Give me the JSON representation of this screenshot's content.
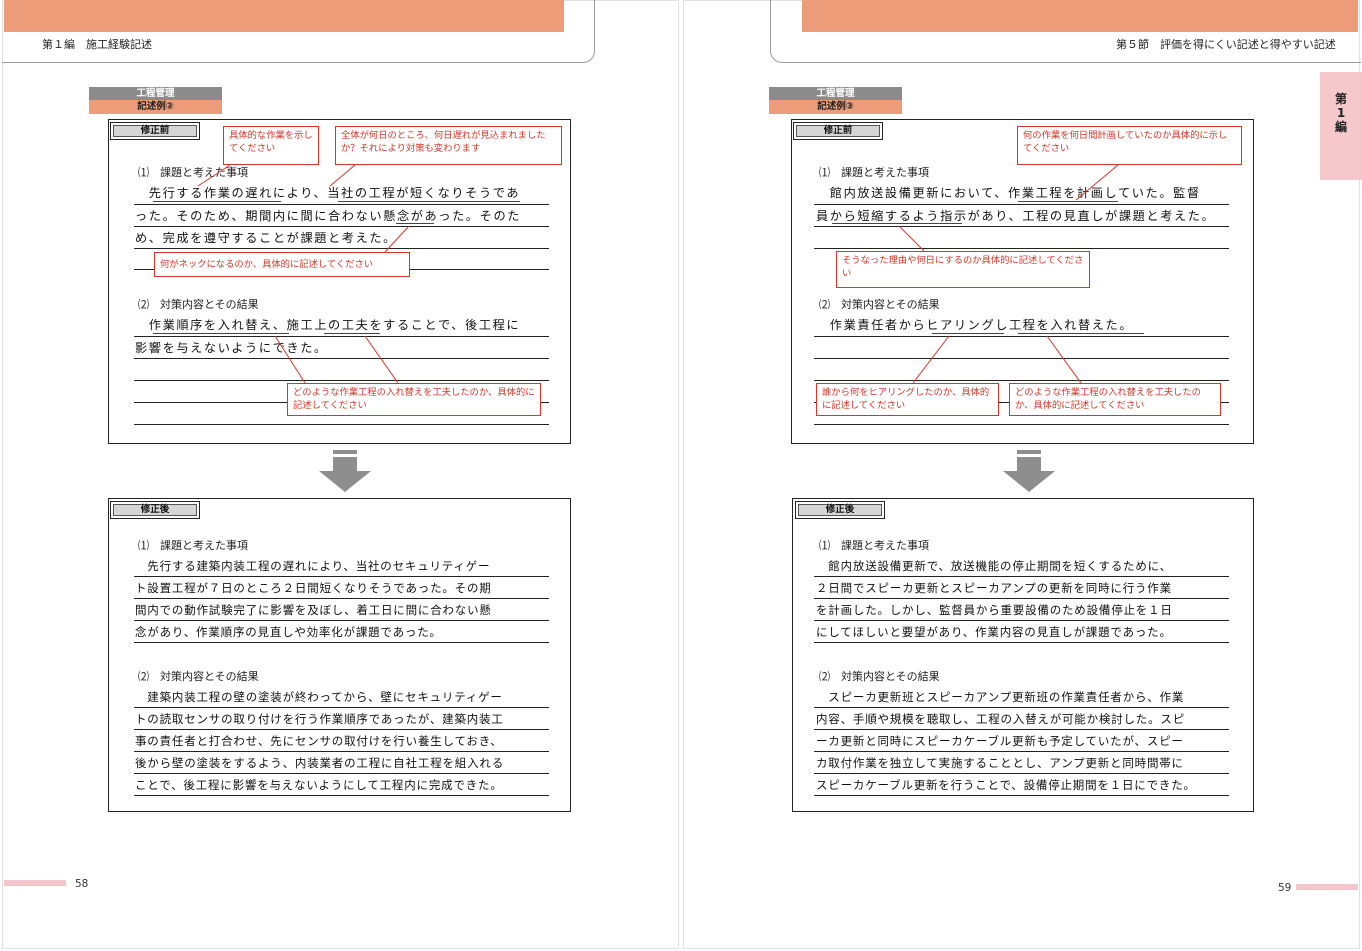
{
  "left": {
    "header": "第１編　施工経験記述",
    "label_category": "工程管理",
    "label_example": "記述例②",
    "before": {
      "tag": "修正前",
      "s1_heading": "⑴　課題と考えた事項",
      "s1_lines": [
        "　先行する作業の遅れにより、当社の工程が短くなりそうであ",
        "った。そのため、期間内に間に合わない懸念があった。そのた",
        "め、完成を遵守することが課題と考えた。"
      ],
      "s2_heading": "⑵　対策内容とその結果",
      "s2_lines": [
        "　作業順序を入れ替え、施工上の工夫をすることで、後工程に",
        "影響を与えないようにできた。"
      ],
      "notes": [
        "具体的な作業を示してください",
        "全体が何日のところ、何日遅れが見込まれましたか？それにより対策も変わります",
        "何がネックになるのか、具体的に記述してください",
        "どのような作業工程の入れ替えを工夫したのか、具体的に記述してください"
      ]
    },
    "after": {
      "tag": "修正後",
      "s1_heading": "⑴　課題と考えた事項",
      "s1_lines": [
        "　先行する建築内装工程の遅れにより、当社のセキュリティゲー",
        "ト設置工程が７日のところ２日間短くなりそうであった。その期",
        "間内での動作試験完了に影響を及ぼし、着工日に間に合わない懸",
        "念があり、作業順序の見直しや効率化が課題であった。"
      ],
      "s2_heading": "⑵　対策内容とその結果",
      "s2_lines": [
        "　建築内装工程の壁の塗装が終わってから、壁にセキュリティゲー",
        "トの読取センサの取り付けを行う作業順序であったが、建築内装工",
        "事の責任者と打合わせ、先にセンサの取付けを行い養生しておき、",
        "後から壁の塗装をするよう、内装業者の工程に自社工程を組入れる",
        "ことで、後工程に影響を与えないようにして工程内に完成できた。"
      ]
    },
    "page_number": "58"
  },
  "right": {
    "header": "第５節　評価を得にくい記述と得やすい記述",
    "side_tab": "第1編",
    "label_category": "工程管理",
    "label_example": "記述例③",
    "before": {
      "tag": "修正前",
      "s1_heading": "⑴　課題と考えた事項",
      "s1_lines": [
        "　館内放送設備更新において、作業工程を計画していた。監督",
        "員から短縮するよう指示があり、工程の見直しが課題と考えた。"
      ],
      "s2_heading": "⑵　対策内容とその結果",
      "s2_lines": [
        "　作業責任者からヒアリングし工程を入れ替えた。"
      ],
      "notes": [
        "何の作業を何日間計画していたのか具体的に示してください",
        "そうなった理由や何日にするのか具体的に記述してください",
        "誰から何をヒアリングしたのか、具体的に記述してください",
        "どのような作業工程の入れ替えを工夫したのか、具体的に記述してください"
      ]
    },
    "after": {
      "tag": "修正後",
      "s1_heading": "⑴　課題と考えた事項",
      "s1_lines": [
        "　館内放送設備更新で、放送機能の停止期間を短くするために、",
        "２日間でスピーカ更新とスピーカアンプの更新を同時に行う作業",
        "を計画した。しかし、監督員から重要設備のため設備停止を１日",
        "にしてほしいと要望があり、作業内容の見直しが課題であった。"
      ],
      "s2_heading": "⑵　対策内容とその結果",
      "s2_lines": [
        "　スピーカ更新班とスピーカアンプ更新班の作業責任者から、作業",
        "内容、手順や規模を聴取し、工程の入替えが可能か検討した。スピ",
        "ーカ更新と同時にスピーカケーブル更新も予定していたが、スピー",
        "カ取付作業を独立して実施することとし、アンプ更新と同時間帯に",
        "スピーカケーブル更新を行うことで、設備停止期間を１日にできた。"
      ]
    },
    "page_number": "59"
  },
  "colors": {
    "accent_orange": "#ec9c78",
    "note_red": "#d8352a",
    "tab_pink": "#f5c8cc",
    "label_gray": "#8c8c8c"
  }
}
